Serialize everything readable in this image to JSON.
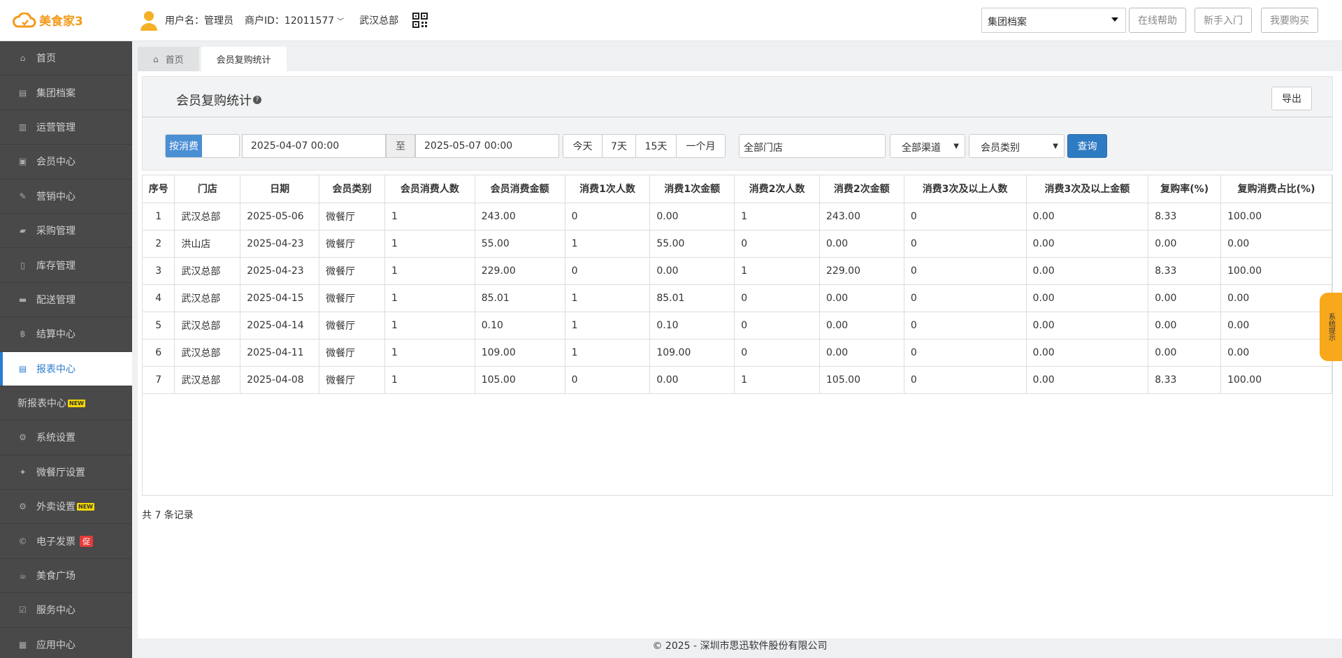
{
  "app": {
    "logo_text": "美食家3",
    "brand_color": "#f39a1a",
    "accent_color": "#2f7bc3"
  },
  "header": {
    "username": "用户名：管理员",
    "merchant_id": "商户ID：12011577",
    "store": "武汉总部",
    "group_select": "集团档案",
    "help_btn": "在线帮助",
    "newbie_btn": "新手入门",
    "buy_btn": "我要购买"
  },
  "sidebar": {
    "items": [
      {
        "label": "首页",
        "icon": "home-icon"
      },
      {
        "label": "集团档案",
        "icon": "file-icon"
      },
      {
        "label": "运营管理",
        "icon": "bar-chart-icon"
      },
      {
        "label": "会员中心",
        "icon": "id-card-icon"
      },
      {
        "label": "营销中心",
        "icon": "edit-icon"
      },
      {
        "label": "采购管理",
        "icon": "book-icon"
      },
      {
        "label": "库存管理",
        "icon": "tablet-icon"
      },
      {
        "label": "配送管理",
        "icon": "truck-icon"
      },
      {
        "label": "结算中心",
        "icon": "bitcoin-icon"
      },
      {
        "label": "报表中心",
        "icon": "report-icon",
        "active": true
      },
      {
        "label": "新报表中心",
        "badge": "NEW"
      },
      {
        "label": "系统设置",
        "icon": "gears-icon"
      },
      {
        "label": "微餐厅设置",
        "icon": "cutlery-icon"
      },
      {
        "label": "外卖设置",
        "icon": "gear-icon",
        "badge": "NEW"
      },
      {
        "label": "电子发票",
        "icon": "copyright-icon",
        "badge": "促"
      },
      {
        "label": "美食广场",
        "icon": "coffee-icon"
      },
      {
        "label": "服务中心",
        "icon": "check-square-icon"
      },
      {
        "label": "应用中心",
        "icon": "grid-icon"
      }
    ]
  },
  "tabs": [
    {
      "label": "首页"
    },
    {
      "label": "会员复购统计"
    }
  ],
  "panel": {
    "title": "会员复购统计",
    "export_btn": "导出",
    "toggle_label": "按消费",
    "date_from": "2025-04-07 00:00",
    "to_label": "至",
    "date_to": "2025-05-07 00:00",
    "quick": [
      "今天",
      "7天",
      "15天",
      "一个月"
    ],
    "store_filter": "全部门店",
    "channel_filter": "全部渠道",
    "member_type_filter": "会员类别",
    "query_btn": "查询"
  },
  "table": {
    "headers": [
      "序号",
      "门店",
      "日期",
      "会员类别",
      "会员消费人数",
      "会员消费金额",
      "消费1次人数",
      "消费1次金额",
      "消费2次人数",
      "消费2次金额",
      "消费3次及以上人数",
      "消费3次及以上金额",
      "复购率(%)",
      "复购消费占比(%)"
    ],
    "rows": [
      [
        "1",
        "武汉总部",
        "2025-05-06",
        "微餐厅",
        "1",
        "243.00",
        "0",
        "0.00",
        "1",
        "243.00",
        "0",
        "0.00",
        "8.33",
        "100.00"
      ],
      [
        "2",
        "洪山店",
        "2025-04-23",
        "微餐厅",
        "1",
        "55.00",
        "1",
        "55.00",
        "0",
        "0.00",
        "0",
        "0.00",
        "0.00",
        "0.00"
      ],
      [
        "3",
        "武汉总部",
        "2025-04-23",
        "微餐厅",
        "1",
        "229.00",
        "0",
        "0.00",
        "1",
        "229.00",
        "0",
        "0.00",
        "8.33",
        "100.00"
      ],
      [
        "4",
        "武汉总部",
        "2025-04-15",
        "微餐厅",
        "1",
        "85.01",
        "1",
        "85.01",
        "0",
        "0.00",
        "0",
        "0.00",
        "0.00",
        "0.00"
      ],
      [
        "5",
        "武汉总部",
        "2025-04-14",
        "微餐厅",
        "1",
        "0.10",
        "1",
        "0.10",
        "0",
        "0.00",
        "0",
        "0.00",
        "0.00",
        "0.00"
      ],
      [
        "6",
        "武汉总部",
        "2025-04-11",
        "微餐厅",
        "1",
        "109.00",
        "1",
        "109.00",
        "0",
        "0.00",
        "0",
        "0.00",
        "0.00",
        "0.00"
      ],
      [
        "7",
        "武汉总部",
        "2025-04-08",
        "微餐厅",
        "1",
        "105.00",
        "0",
        "0.00",
        "1",
        "105.00",
        "0",
        "0.00",
        "8.33",
        "100.00"
      ]
    ]
  },
  "total_text": "共 7 条记录",
  "footer": "© 2025 - 深圳市思迅软件股份有限公司",
  "side_tip": "系统提示"
}
